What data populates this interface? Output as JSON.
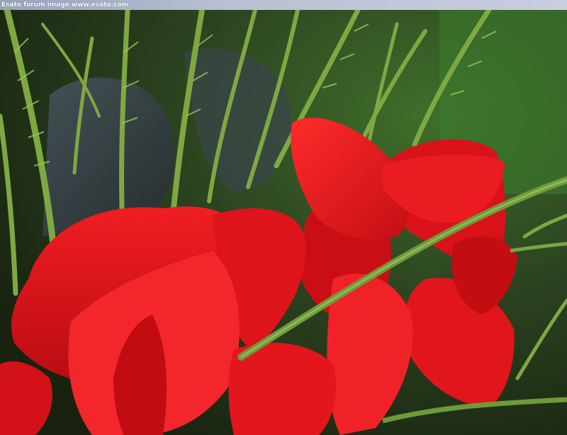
{
  "caption": "Esato forum image www.esato.com",
  "colors": {
    "petal_red": "#e0141a",
    "petal_dark": "#a00a10",
    "foliage_green": "#5f8a2c",
    "background_dark": "#1e2a18",
    "caption_bar": "#b4bbd0"
  }
}
